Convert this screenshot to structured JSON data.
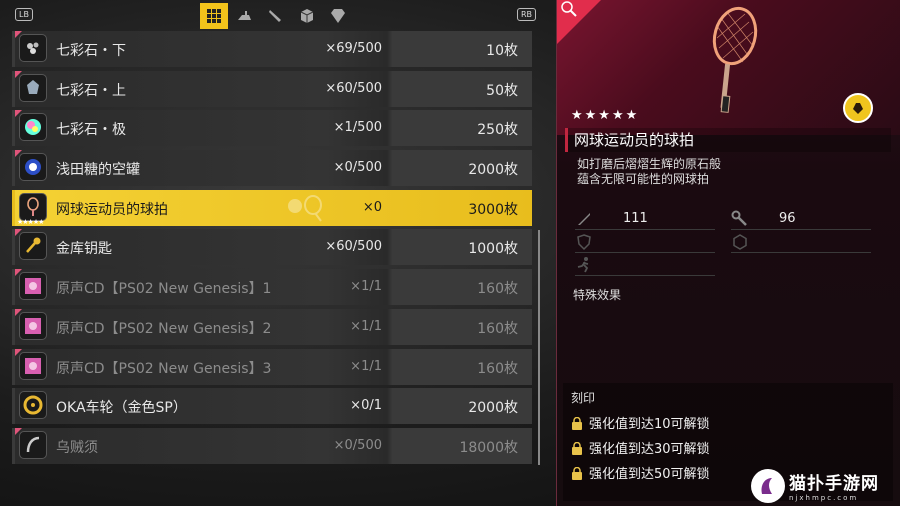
{
  "topbar": {
    "left_button": "LB",
    "right_button": "RB",
    "tabs": [
      {
        "icon": "grid-icon",
        "active": true
      },
      {
        "icon": "iron-icon",
        "active": false
      },
      {
        "icon": "knife-icon",
        "active": false
      },
      {
        "icon": "box-icon",
        "active": false
      },
      {
        "icon": "gem-icon",
        "active": false
      }
    ]
  },
  "items": [
    {
      "name": "七彩石・下",
      "qty": "×69/500",
      "price": "10枚",
      "icon": "stones-icon"
    },
    {
      "name": "七彩石・上",
      "qty": "×60/500",
      "price": "50枚",
      "icon": "stone-icon"
    },
    {
      "name": "七彩石・极",
      "qty": "×1/500",
      "price": "250枚",
      "icon": "rainbow-stone-icon"
    },
    {
      "name": "浅田糖的空罐",
      "qty": "×0/500",
      "price": "2000枚",
      "icon": "can-icon"
    },
    {
      "name": "网球运动员的球拍",
      "qty": "×0",
      "price": "3000枚",
      "icon": "racket-icon",
      "stars": "★★★★★"
    },
    {
      "name": "金库钥匙",
      "qty": "×60/500",
      "price": "1000枚",
      "icon": "key-icon"
    },
    {
      "name": "原声CD【PS02 New Genesis】1",
      "qty": "×1/1",
      "price": "160枚",
      "icon": "cd-icon"
    },
    {
      "name": "原声CD【PS02 New Genesis】2",
      "qty": "×1/1",
      "price": "160枚",
      "icon": "cd-icon"
    },
    {
      "name": "原声CD【PS02 New Genesis】3",
      "qty": "×1/1",
      "price": "160枚",
      "icon": "cd-icon"
    },
    {
      "name": "OKA车轮（金色SP）",
      "qty": "×0/1",
      "price": "2000枚",
      "icon": "wheel-icon"
    },
    {
      "name": "乌贼须",
      "qty": "×0/500",
      "price": "18000枚",
      "icon": "tentacle-icon"
    }
  ],
  "detail": {
    "stars": "★★★★★",
    "title": "网球运动员的球拍",
    "description": "如打磨后熠熠生辉的原石般\n蕴含无限可能性的网球拍",
    "attack": "111",
    "durability": "96",
    "special_label": "特殊效果",
    "inscribe_label": "刻印",
    "unlocks": [
      "强化值到达10可解锁",
      "强化值到达30可解锁",
      "强化值到达50可解锁"
    ]
  },
  "watermark": {
    "title": "猫扑手游网",
    "url": "njxhmpc.com"
  },
  "colors": {
    "accent_yellow": "#f2c31b",
    "accent_red": "#e12d4c"
  }
}
